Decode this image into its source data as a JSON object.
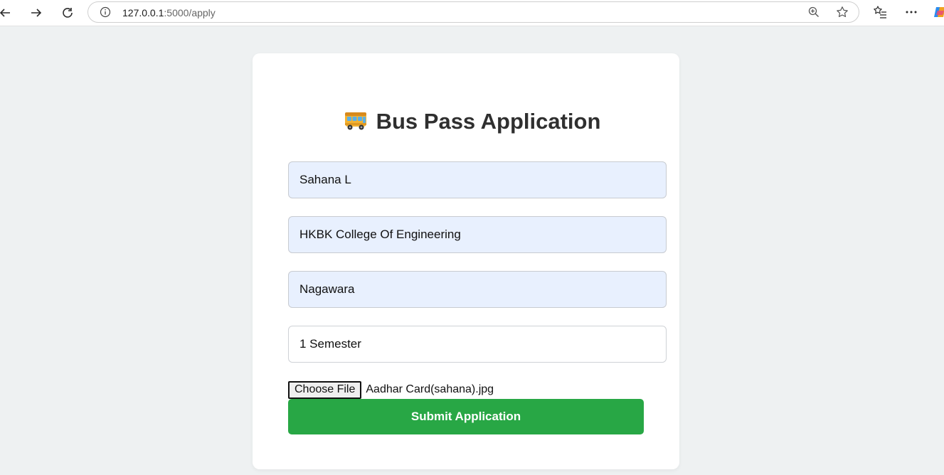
{
  "browser": {
    "url_host": "127.0.0.1",
    "url_path": ":5000/apply"
  },
  "form": {
    "title": "Bus Pass Application",
    "title_icon": "bus-emoji",
    "fields": [
      {
        "name": "name",
        "value": "Sahana L"
      },
      {
        "name": "college",
        "value": "HKBK College Of Engineering"
      },
      {
        "name": "stop",
        "value": "Nagawara"
      },
      {
        "name": "semester",
        "value": "1 Semester"
      }
    ],
    "file_button_label": "Choose File",
    "file_name": "Aadhar Card(sahana).jpg",
    "submit_label": "Submit Application",
    "submit_color": "#28a745",
    "autofill_bg": "#e8f0fe"
  }
}
